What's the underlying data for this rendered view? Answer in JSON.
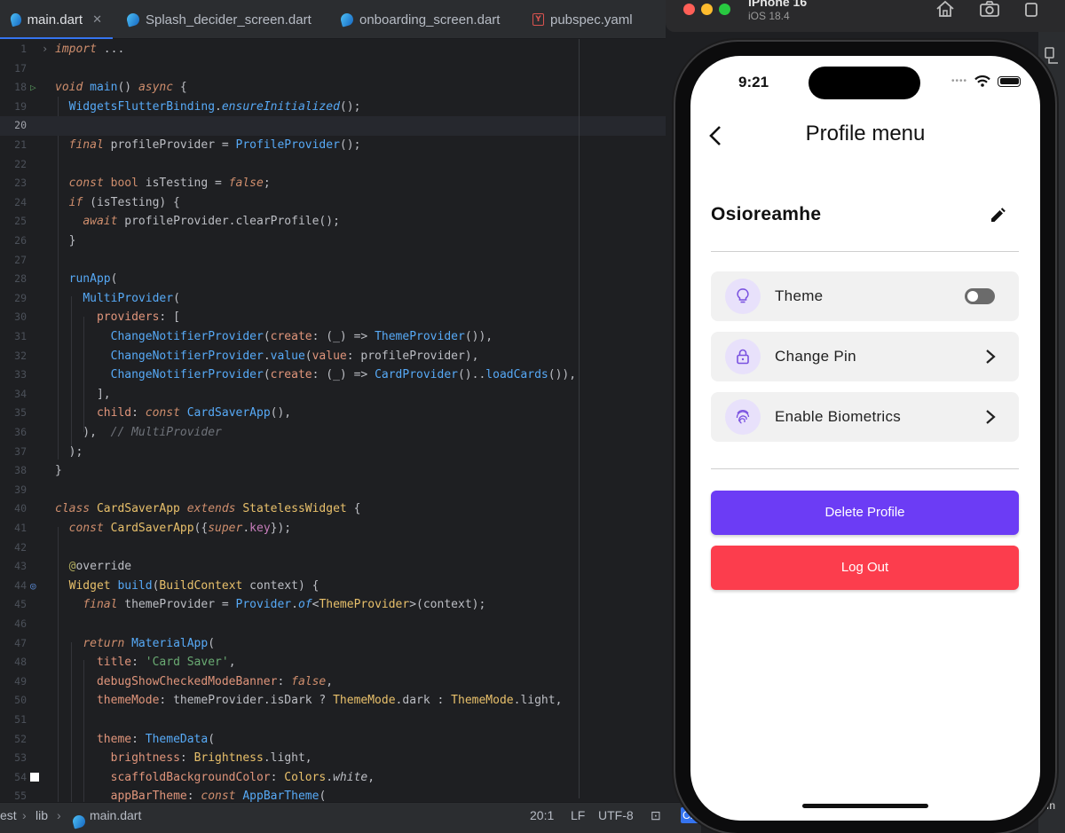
{
  "tabs": [
    {
      "label": "main.dart",
      "icon": "dart-icon",
      "active": true
    },
    {
      "label": "Splash_decider_screen.dart",
      "icon": "dart-icon"
    },
    {
      "label": "onboarding_screen.dart",
      "icon": "dart-icon"
    },
    {
      "label": "pubspec.yaml",
      "icon": "yaml-icon"
    }
  ],
  "statusbar": {
    "crumb_root": "est",
    "crumb_lib": "lib",
    "crumb_file": "main.dart",
    "position": "20:1",
    "line_ending": "LF",
    "encoding": "UTF-8",
    "badge": "CN"
  },
  "simulator": {
    "device": "iPhone 16",
    "os": "iOS 18.4"
  },
  "app": {
    "time": "9:21",
    "title": "Profile menu",
    "profile_name": "Osioreamhe",
    "menu": [
      {
        "label": "Theme",
        "icon": "lightbulb-icon",
        "control": "toggle",
        "toggle_on": false
      },
      {
        "label": "Change Pin",
        "icon": "lock-icon",
        "control": "chevron"
      },
      {
        "label": "Enable Biometrics",
        "icon": "fingerprint-icon",
        "control": "chevron"
      }
    ],
    "delete_label": "Delete Profile",
    "logout_label": "Log Out",
    "colors": {
      "delete": "#6c3cf5",
      "logout": "#fc3d4d",
      "icon_bg": "#e8e1fb",
      "icon_fg": "#7a52e0"
    }
  }
}
